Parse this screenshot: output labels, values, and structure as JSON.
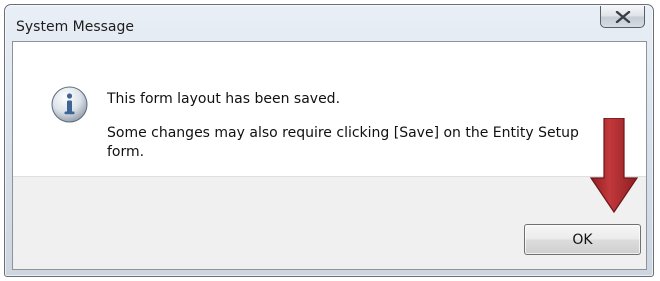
{
  "window": {
    "title": "System Message"
  },
  "titlebar": {
    "close_icon": "close-icon"
  },
  "message": {
    "icon": "information-icon",
    "line1": "This form layout has been saved.",
    "line2": "Some changes may also require clicking [Save] on the Entity Setup form."
  },
  "buttons": {
    "ok_label": "OK"
  },
  "annotation": {
    "icon": "red-down-arrow-icon",
    "color": "#a8282c"
  },
  "colors": {
    "footer_bg": "#f0f0f0",
    "info_blue": "#3e6596"
  }
}
